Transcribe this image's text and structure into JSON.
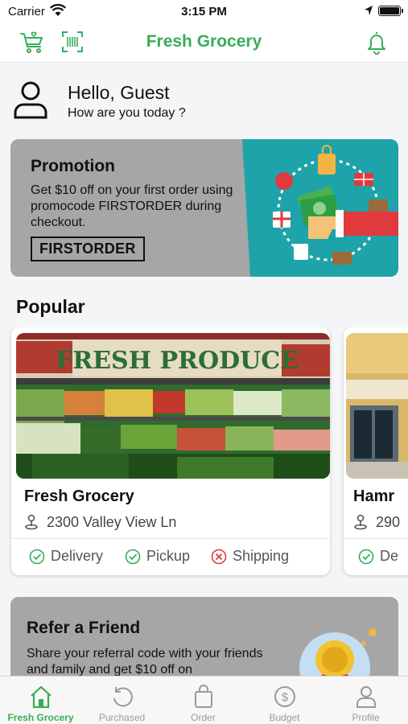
{
  "status_bar": {
    "carrier": "Carrier",
    "time": "3:15 PM"
  },
  "nav": {
    "title": "Fresh Grocery",
    "icons": [
      "cart-heart-icon",
      "barcode-scan-icon",
      "bell-icon"
    ],
    "accent_color": "#37ad5a"
  },
  "greeting": {
    "hello": "Hello, Guest",
    "subtitle": "How are you today ?"
  },
  "promotion": {
    "title": "Promotion",
    "description": "Get $10 off on your first order using promocode FIRSTORDER during checkout.",
    "code": "FIRSTORDER",
    "colors": {
      "card": "#a6a6a6",
      "art_bg": "#1fa3aa"
    }
  },
  "popular": {
    "title": "Popular",
    "stores": [
      {
        "name": "Fresh Grocery",
        "address": "2300 Valley View Ln",
        "image_sign": "FRESH PRODUCE",
        "services": [
          {
            "label": "Delivery",
            "available": true
          },
          {
            "label": "Pickup",
            "available": true
          },
          {
            "label": "Shipping",
            "available": false
          }
        ]
      },
      {
        "name": "Hamr",
        "address": "290",
        "services": [
          {
            "label": "De",
            "available": true
          }
        ]
      }
    ],
    "colors": {
      "available": "#37ad5a",
      "unavailable": "#e0393e"
    }
  },
  "refer": {
    "title": "Refer a Friend",
    "description": "Share your referral code with your friends and family and get $10 off on"
  },
  "tab_bar": {
    "tabs": [
      {
        "label": "Fresh Grocery",
        "icon": "home-icon",
        "active": true
      },
      {
        "label": "Purchased",
        "icon": "history-icon",
        "active": false
      },
      {
        "label": "Order",
        "icon": "bag-icon",
        "active": false
      },
      {
        "label": "Budget",
        "icon": "dollar-icon",
        "active": false
      },
      {
        "label": "Profile",
        "icon": "person-icon",
        "active": false
      }
    ]
  }
}
